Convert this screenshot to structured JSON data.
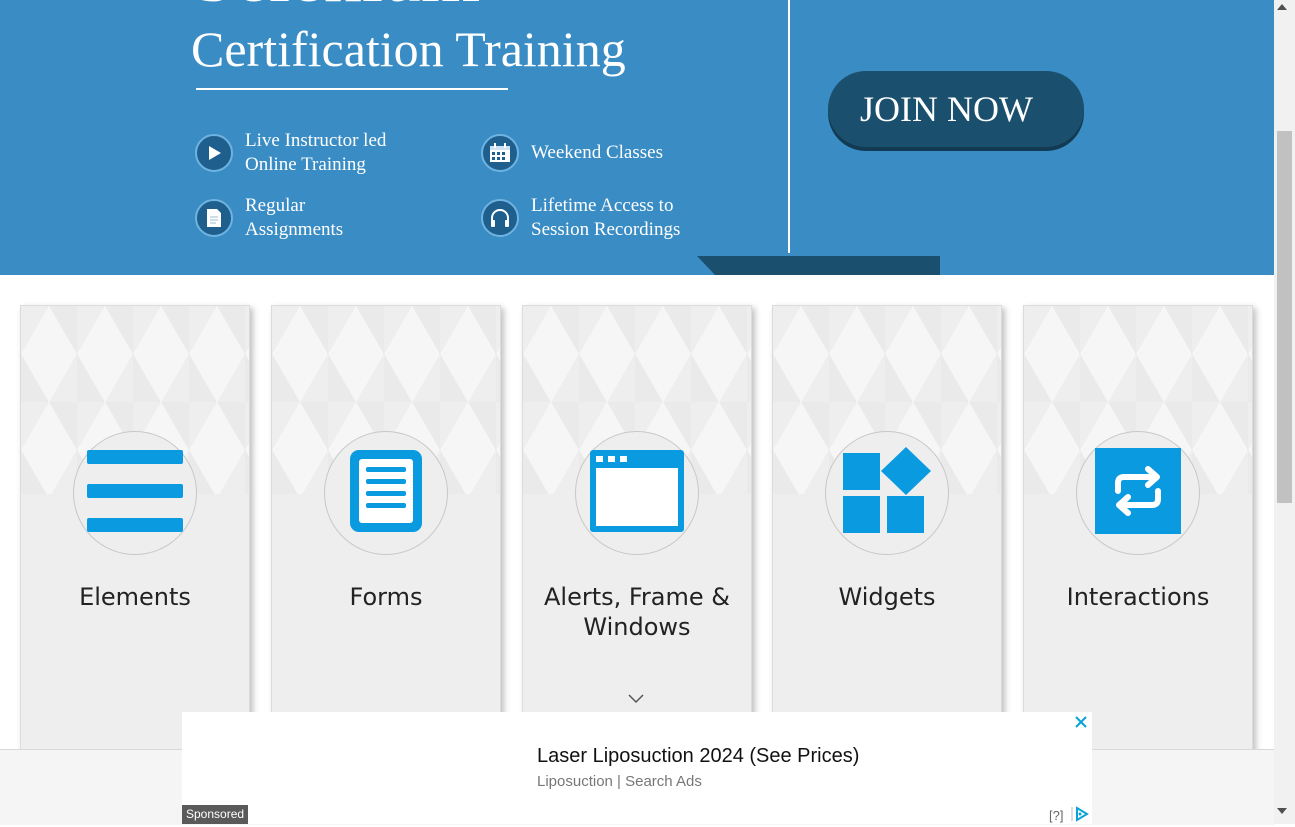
{
  "banner": {
    "big_title": "Selenium",
    "title": "Certification Training",
    "features": [
      {
        "icon": "play-icon",
        "text": "Live Instructor led\nOnline Training"
      },
      {
        "icon": "calendar-icon",
        "text": "Weekend Classes"
      },
      {
        "icon": "document-icon",
        "text": "Regular\nAssignments"
      },
      {
        "icon": "headphones-icon",
        "text": "Lifetime Access to\nSession Recordings"
      }
    ],
    "join_label": "JOIN NOW",
    "colors": {
      "background": "#3a8cc4",
      "dark": "#1b4f6e"
    }
  },
  "cards": [
    {
      "title": "Elements",
      "icon": "list-icon"
    },
    {
      "title": "Forms",
      "icon": "form-icon"
    },
    {
      "title": "Alerts, Frame & Windows",
      "icon": "window-icon"
    },
    {
      "title": "Widgets",
      "icon": "widgets-icon"
    },
    {
      "title": "Interactions",
      "icon": "interactions-icon"
    }
  ],
  "accent_color": "#0a9ae0",
  "ad": {
    "headline": "Laser Liposuction 2024 (See Prices)",
    "subline": "Liposuction | Search Ads",
    "sponsored": "Sponsored",
    "help": "[?]",
    "close_icon": "close-icon",
    "adchoices_icon": "adchoices-icon"
  }
}
